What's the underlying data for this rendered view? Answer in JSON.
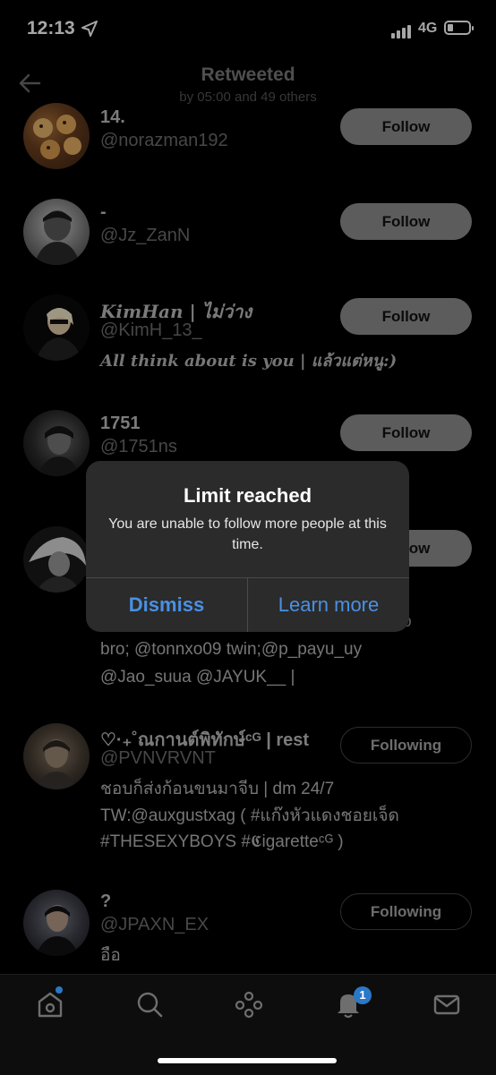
{
  "status_bar": {
    "time": "12:13",
    "network": "4G"
  },
  "header": {
    "title": "Retweeted",
    "subtitle": "by 05:00 and 49 others"
  },
  "users": [
    {
      "name": "14.",
      "handle": "@norazman192",
      "button": "Follow",
      "avatar": "food-avatar"
    },
    {
      "name": "-",
      "handle": "@Jz_ZanN",
      "button": "Follow",
      "avatar": "person-avatar"
    },
    {
      "name": "KimHan | ไม่ว่าง",
      "handle": "@KimH_13_",
      "bio": "All think about is you | แล้วแต่หนู:)",
      "button": "Follow",
      "avatar": "person-avatar"
    },
    {
      "name": "1751",
      "handle": "@1751ns",
      "button": "Follow",
      "avatar": "person-avatar"
    },
    {
      "name": "",
      "handle": "",
      "bio_line1": "ooo",
      "bio_line2": "bro; @tonnxo09 twin;@p_payu_uy",
      "bio_line3": "@Jao_suua @JAYUK__ |",
      "button": "Follow",
      "avatar": "person-avatar"
    },
    {
      "name": "♡·₊˚ณกานต์พิทักษ์ᶜᴳ | rest",
      "handle": "@PVNVRVNT",
      "bio_line1": "ชอบก็ส่งก้อนขนมาจีบ | dm 24/7",
      "bio_line2": "TW:@auxgustxag ( #แก๊งหัวแดงชอยเจ็ด",
      "bio_line3": "#THESEXYBOYS #𝕮igaretteᶜᴳ )",
      "button": "Following",
      "avatar": "person-avatar"
    },
    {
      "name": "?",
      "handle": "@JPAXN_EX",
      "bio": "อือ",
      "button": "Following",
      "avatar": "person-avatar"
    }
  ],
  "alert": {
    "title": "Limit reached",
    "message": "You are unable to follow more people at this time.",
    "dismiss": "Dismiss",
    "learn_more": "Learn more"
  },
  "tabbar": {
    "notifications_badge": "1"
  },
  "colors": {
    "accent": "#4a90e2",
    "badge": "#2a78c8"
  }
}
